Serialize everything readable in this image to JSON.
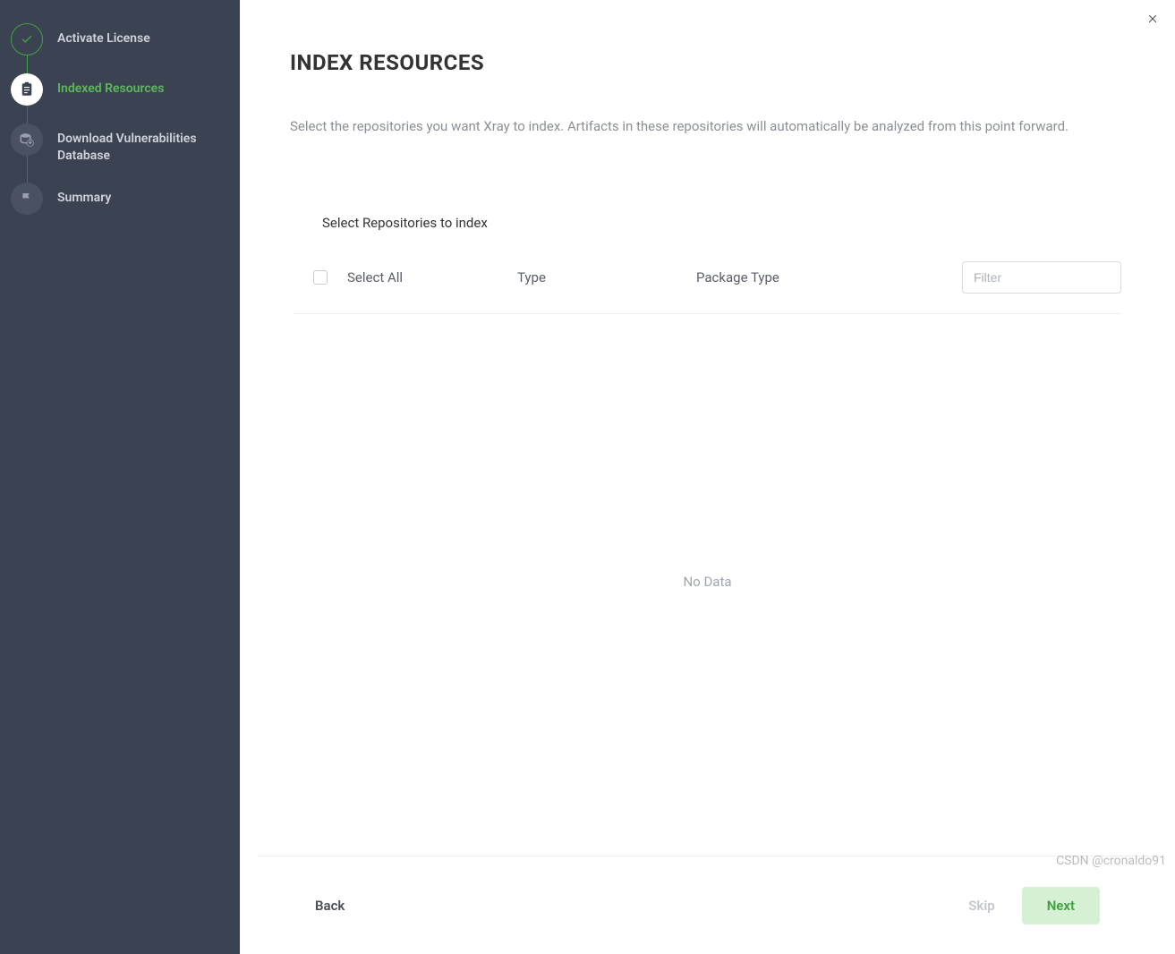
{
  "sidebar": {
    "steps": [
      {
        "label": "Activate License",
        "state": "completed"
      },
      {
        "label": "Indexed Resources",
        "state": "active"
      },
      {
        "label": "Download Vulnerabilities Database",
        "state": "pending"
      },
      {
        "label": "Summary",
        "state": "pending"
      }
    ]
  },
  "page": {
    "title": "INDEX RESOURCES",
    "description": "Select the repositories you want Xray to index. Artifacts in these repositories will automatically be analyzed from this point forward."
  },
  "table": {
    "section_title": "Select Repositories to index",
    "columns": {
      "select_all": "Select All",
      "type": "Type",
      "package_type": "Package Type"
    },
    "filter_placeholder": "Filter",
    "empty_text": "No Data"
  },
  "footer": {
    "back": "Back",
    "skip": "Skip",
    "next": "Next"
  },
  "watermark": "CSDN @cronaldo91"
}
